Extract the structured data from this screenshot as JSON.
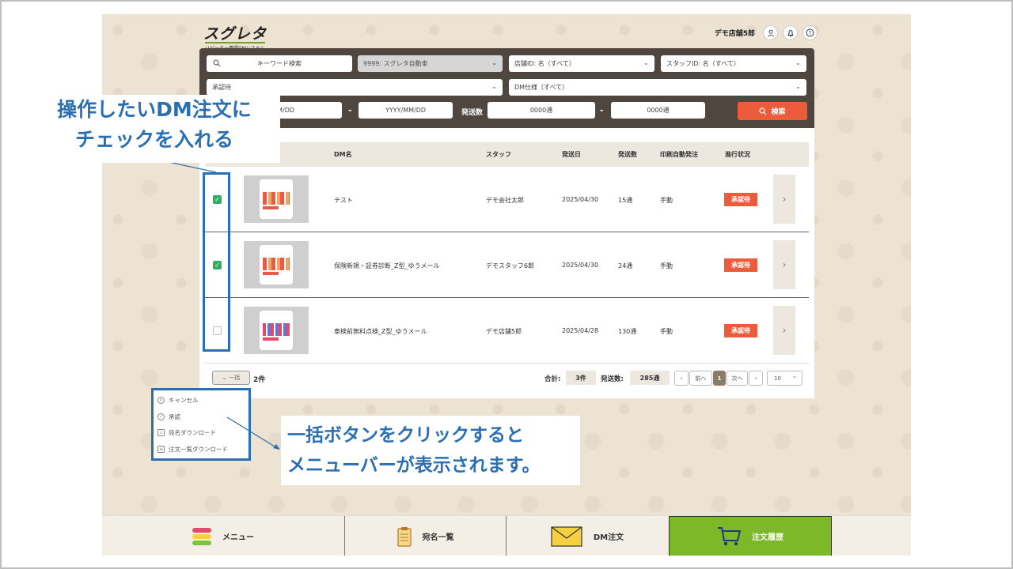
{
  "header": {
    "logo_text": "スグレタ",
    "logo_sub": "リピーター獲得DMシステム",
    "user_name": "デモ店舗5郎",
    "icons": [
      "user-icon",
      "bell-icon",
      "help-icon"
    ]
  },
  "filters": {
    "keyword_placeholder": "キーワード検索",
    "company": "9999: スグレタ自動車",
    "store": "店舗ID: 名（すべて）",
    "staff": "スタッフID: 名（すべて）",
    "status": "承認待",
    "dm_spec": "DM仕様（すべて）",
    "date_from": "YYYY/MM/DD",
    "date_to": "YYYY/MM/DD",
    "dash": "-",
    "send_count_label": "発送数",
    "count_from": "0000通",
    "count_to": "0000通",
    "search_button": "検索"
  },
  "table": {
    "columns": [
      "DM名",
      "スタッフ",
      "発送日",
      "発送数",
      "印刷自動発注",
      "進行状況"
    ],
    "rows": [
      {
        "checked": true,
        "name": "テスト",
        "staff": "デモ会社太郎",
        "date": "2025/04/30",
        "count": "15通",
        "auto": "手動",
        "status": "承認待"
      },
      {
        "checked": true,
        "name": "保険新規・証券診断_Z型_ゆうメール",
        "staff": "デモスタッフ6郎",
        "date": "2025/04/30",
        "count": "24通",
        "auto": "手動",
        "status": "承認待"
      },
      {
        "checked": false,
        "name": "車検前無料点検_Z型_ゆうメール",
        "staff": "デモ店舗5郎",
        "date": "2025/04/28",
        "count": "130通",
        "auto": "手動",
        "status": "承認待"
      }
    ]
  },
  "footer": {
    "bulk_label": "一括",
    "item_count": "2件",
    "total_label": "合計:",
    "total_value": "3件",
    "sent_label": "発送数:",
    "sent_value": "285通",
    "prev": "前へ",
    "page": "1",
    "next": "次へ",
    "per_page": "10"
  },
  "bulk_menu": {
    "items": [
      "キャンセル",
      "承認",
      "宛名ダウンロード",
      "注文一覧ダウンロード"
    ]
  },
  "bottom_nav": {
    "items": [
      "メニュー",
      "宛名一覧",
      "DM注文",
      "注文履歴"
    ]
  },
  "annotations": {
    "callout1_line1": "操作したいDM注文に",
    "callout1_line2": "チェックを入れる",
    "callout2_line1": "一括ボタンをクリックすると",
    "callout2_line2": "メニューバーが表示されます。"
  },
  "colors": {
    "accent": "#ec5b3a",
    "annotation": "#2a6fb2",
    "active_nav": "#7cb828",
    "filter_bg": "#4f4640"
  }
}
